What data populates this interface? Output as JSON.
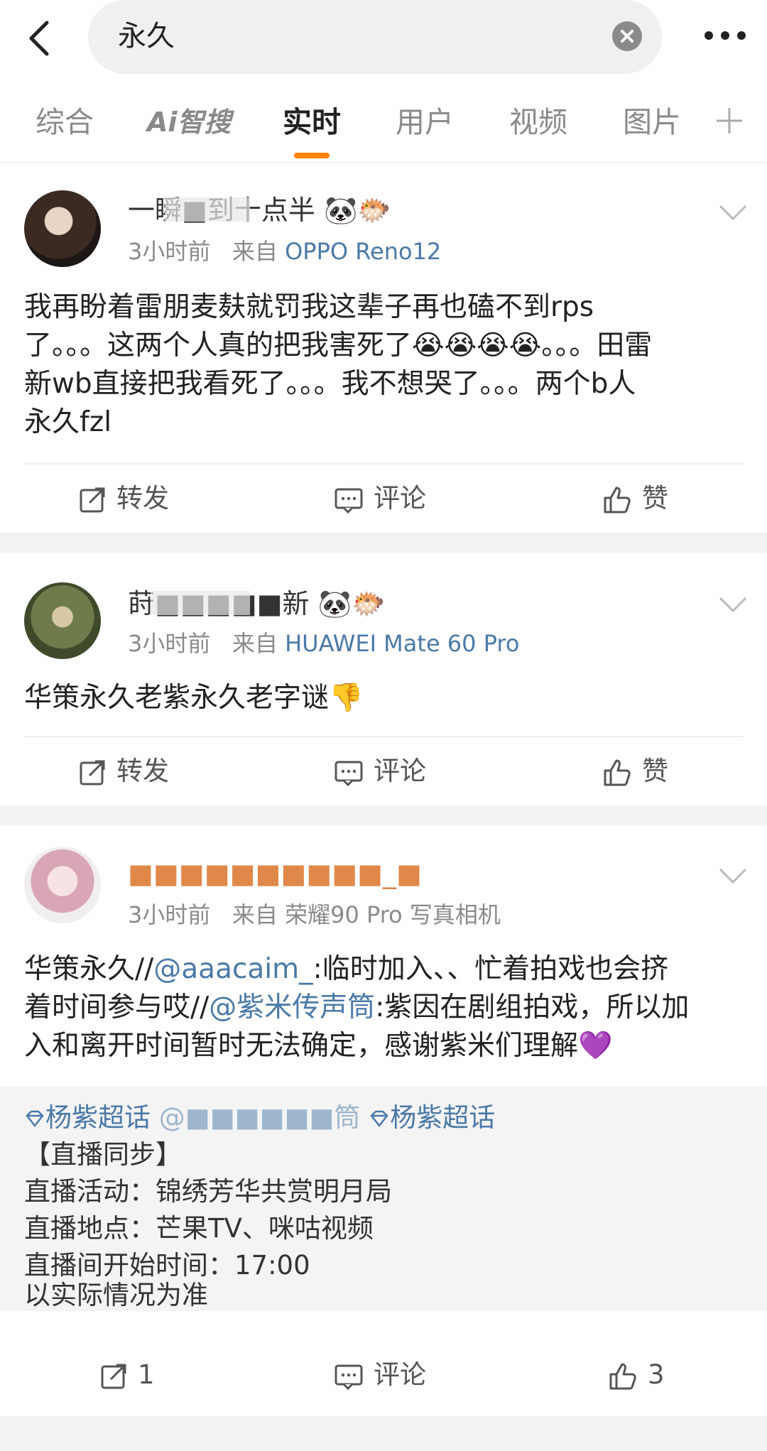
{
  "search": {
    "query": "永久",
    "back_icon": "chevron-left-icon",
    "clear_icon": "close-circle-icon",
    "more_icon": "more-horizontal-icon"
  },
  "tabs": [
    {
      "label": "综合"
    },
    {
      "label": "Ai智搜"
    },
    {
      "label": "实时"
    },
    {
      "label": "用户"
    },
    {
      "label": "视频"
    },
    {
      "label": "图片"
    }
  ],
  "active_tab": "实时",
  "accent_color": "#ff8200",
  "link_color": "#4a79a8",
  "posts": [
    {
      "username": "一瞬■到十点半",
      "time": "3小时前",
      "from_label": "来自",
      "source": "OPPO Reno12",
      "text_lines": [
        "我再盼着雷朋麦麸就罚我这辈子再也磕不到rps",
        "了。。。这两个人真的把我害死了😭😭😭😭。。。田雷",
        "新wb直接把我看死了。。。我不想哭了。。。两个b人",
        "永久fzl"
      ],
      "actions": {
        "repost": "转发",
        "comment": "评论",
        "like": "赞"
      }
    },
    {
      "username": "莳■■■■■新",
      "time": "3小时前",
      "from_label": "来自",
      "source": "HUAWEI Mate 60 Pro",
      "text_lines": [
        "华策永久老紫永久老字谜👎"
      ],
      "actions": {
        "repost": "转发",
        "comment": "评论",
        "like": "赞"
      }
    },
    {
      "username": "■■■■■■■■■■_■",
      "time": "3小时前",
      "from_label": "来自",
      "source": "荣耀90 Pro 写真相机",
      "text_line1_a": "华策永久//",
      "text_line1_mention": "@aaacaim_",
      "text_line1_b": ":临时加入、、忙着拍戏也会挤",
      "text_line2_a": "着时间参与哎//",
      "text_line2_mention": "@紫米传声筒",
      "text_line2_b": ":紫因在剧组拍戏，所以加",
      "text_line3": "入和离开时间暂时无法确定，感谢紫米们理解💜",
      "repost": {
        "topic1": "杨紫超话",
        "blurred_mention": "@■■■■■■筒",
        "topic2": "杨紫超话",
        "lines": [
          "【直播同步】",
          "直播活动：锦绣芳华共赏明月局",
          "直播地点：芒果TV、咪咕视频",
          "直播间开始时间：17:00",
          "以实际情况为准"
        ]
      },
      "actions": {
        "repost": "1",
        "comment": "评论",
        "like": "3"
      }
    }
  ]
}
